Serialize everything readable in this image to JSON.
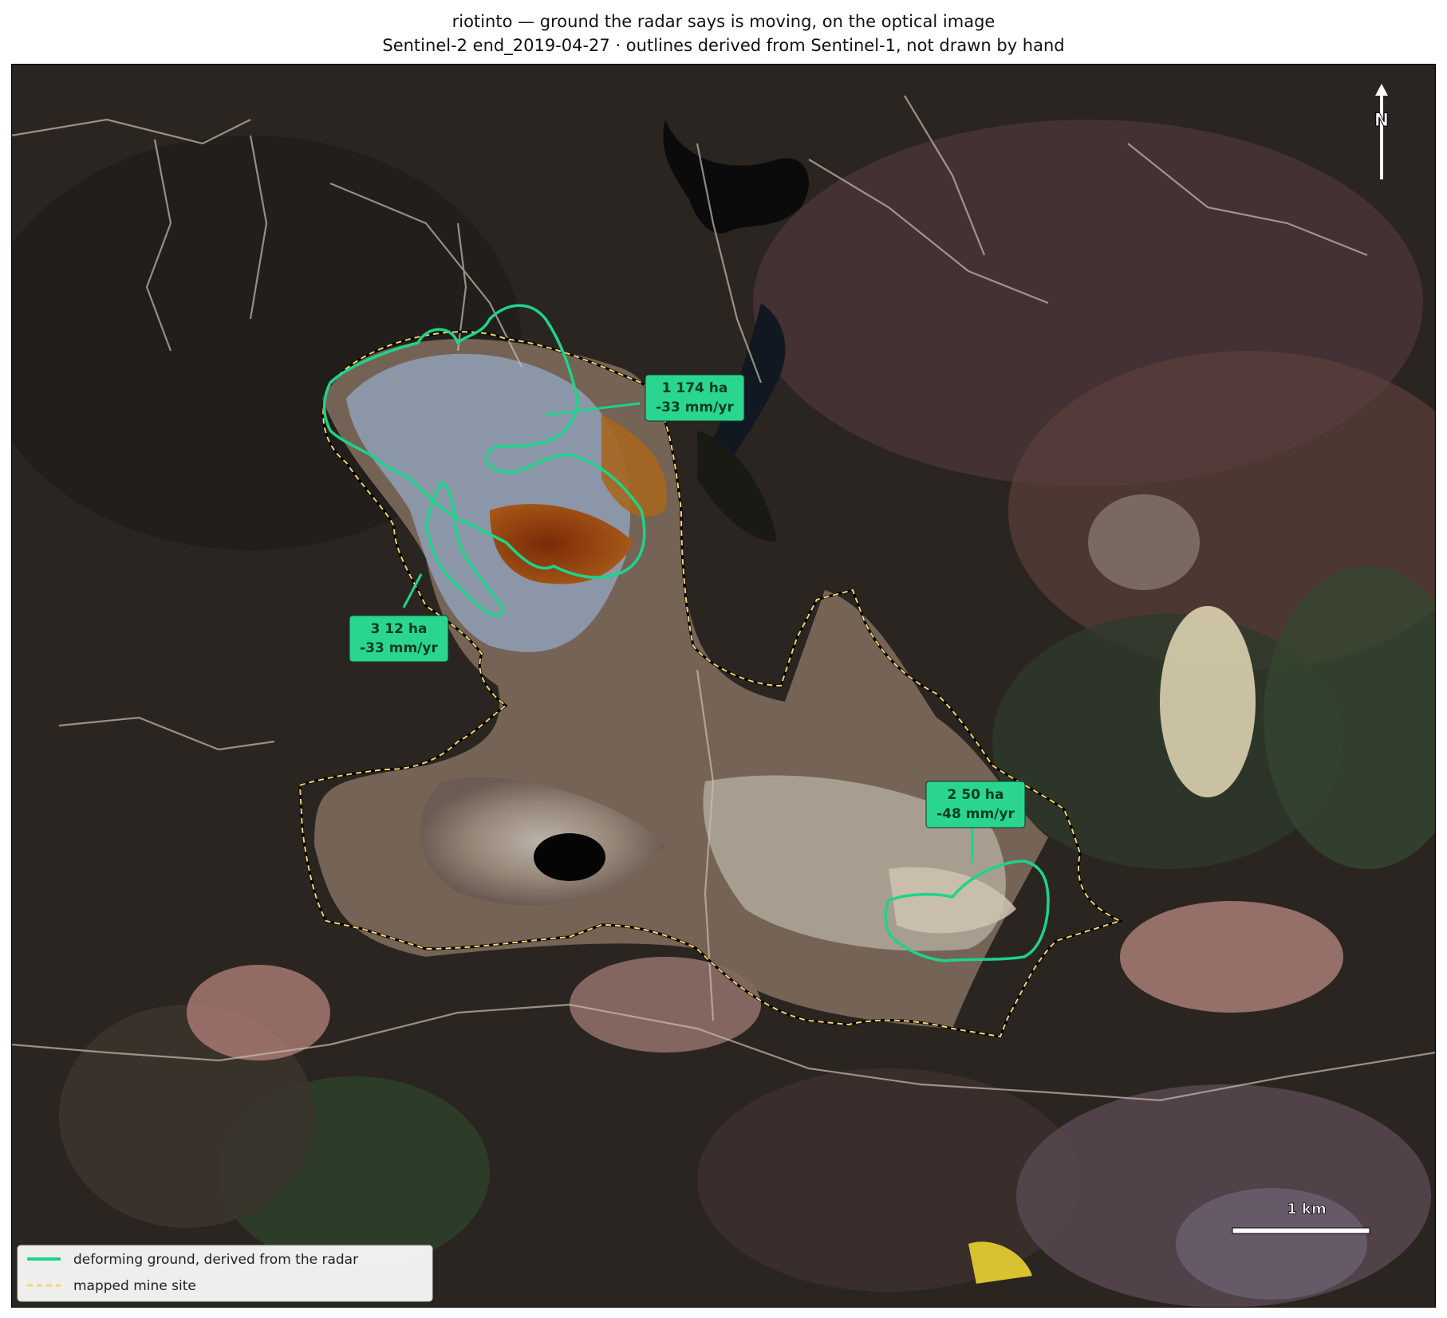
{
  "title": "riotinto — ground the radar says is moving, on the optical image",
  "subtitle": "Sentinel-2 end_2019-04-27  ·  outlines derived from Sentinel-1, not drawn by hand",
  "north_arrow": {
    "label": "N",
    "icon": "north-arrow-icon"
  },
  "scale_bar": {
    "label": "1 km"
  },
  "zones": [
    {
      "id": "1",
      "area": "174 ha",
      "rate": "-33 mm/yr",
      "line1": "1  174 ha",
      "line2": "-33 mm/yr"
    },
    {
      "id": "2",
      "area": "50 ha",
      "rate": "-48 mm/yr",
      "line1": "2  50 ha",
      "line2": "-48 mm/yr"
    },
    {
      "id": "3",
      "area": "12 ha",
      "rate": "-33 mm/yr",
      "line1": "3  12 ha",
      "line2": "-33 mm/yr"
    }
  ],
  "legend": {
    "items": [
      {
        "label": "deforming ground, derived from the radar",
        "style": "solid",
        "color": "#1ed38a"
      },
      {
        "label": "mapped mine site",
        "style": "dashed",
        "color": "#f5d76e"
      }
    ]
  },
  "colors": {
    "deformation_outline": "#1ed38a",
    "mine_outline": "#f5d76e",
    "label_fill": "#2ad68f",
    "label_text": "#0b3b24"
  }
}
